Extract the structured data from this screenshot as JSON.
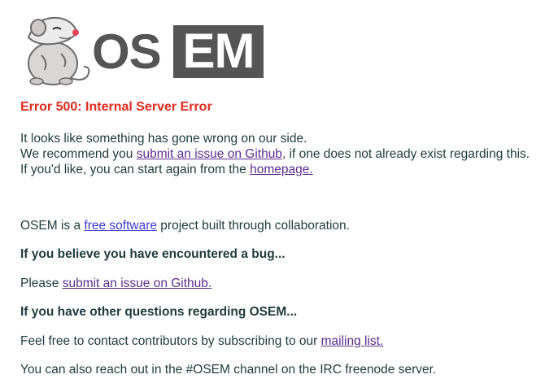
{
  "logo": {
    "text_left": "OS",
    "text_right": "EM"
  },
  "error": {
    "title": "Error 500: Internal Server Error",
    "line1": "It looks like something has gone wrong on our side.",
    "line2_prefix": "We recommend you ",
    "line2_link": "submit an issue on Github",
    "line2_suffix": ", if one does not already exist regarding this.",
    "line3_prefix": "If you'd like, you can start again from the ",
    "line3_link": "homepage."
  },
  "footer": {
    "intro_prefix": "OSEM is a ",
    "intro_link": "free software",
    "intro_suffix": " project built through collaboration.",
    "bug_heading": "If you believe you have encountered a bug...",
    "bug_prefix": "Please ",
    "bug_link": "submit an issue on Github.",
    "questions_heading": "If you have other questions regarding OSEM...",
    "contact_prefix": "Feel free to contact contributors by subscribing to our ",
    "contact_link": "mailing list.",
    "irc_text": "You can also reach out in the #OSEM channel on the IRC freenode server."
  },
  "colors": {
    "error": "#e02b1f",
    "text": "#1f3a3d",
    "visited_link": "#5b2d8e",
    "link": "#3a3ad6",
    "logo_gray": "#555555"
  }
}
